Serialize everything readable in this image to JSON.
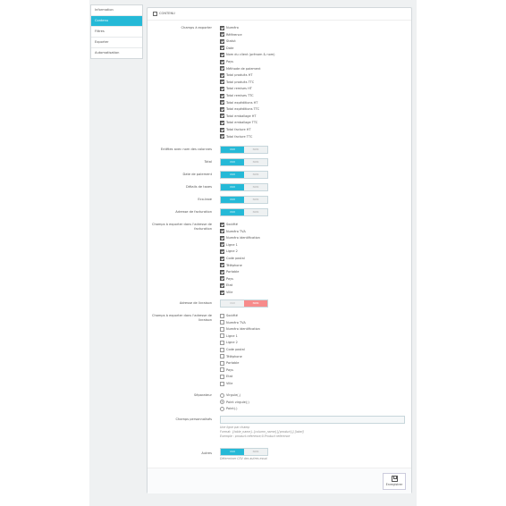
{
  "sidebar": {
    "items": [
      {
        "label": "Information",
        "active": false
      },
      {
        "label": "Contenu",
        "active": true
      },
      {
        "label": "Filtres",
        "active": false
      },
      {
        "label": "Exporter",
        "active": false
      },
      {
        "label": "Automatisation",
        "active": false
      }
    ]
  },
  "panel": {
    "title": "CONTENU"
  },
  "labels": {
    "fields": "Champs à exporter",
    "headers": "Entêtes avec nom des colonnes",
    "total": "Total",
    "payment_date": "Date de paiement",
    "tax_details": "Détails de taxes",
    "ecotax": "Eco-taxe",
    "invoice_address": "Adresse de facturation",
    "invoice_fields": "Champs à exporter dans l'adresse de facturation",
    "delivery_address": "Adresse de livraison",
    "delivery_fields": "Champs à exporter dans l'adresse de livraison",
    "separator": "Séparateur",
    "custom_fields": "Champs personnalisés",
    "others": "Autres"
  },
  "fields": [
    {
      "label": "Numéro",
      "checked": true
    },
    {
      "label": "Référence",
      "checked": true
    },
    {
      "label": "Statut",
      "checked": true
    },
    {
      "label": "Date",
      "checked": true
    },
    {
      "label": "Nom du client (prénom & nom)",
      "checked": true
    },
    {
      "label": "Pays",
      "checked": true
    },
    {
      "label": "Méthode de paiement",
      "checked": true
    },
    {
      "label": "Total produits HT",
      "checked": true
    },
    {
      "label": "Total produits TTC",
      "checked": true
    },
    {
      "label": "Total remises HT",
      "checked": true
    },
    {
      "label": "Total remises TTC",
      "checked": true
    },
    {
      "label": "Total expéditions HT",
      "checked": true
    },
    {
      "label": "Total expéditions TTC",
      "checked": true
    },
    {
      "label": "Total emballage HT",
      "checked": true
    },
    {
      "label": "Total emballage TTC",
      "checked": true
    },
    {
      "label": "Total facture HT",
      "checked": true
    },
    {
      "label": "Total facture TTC",
      "checked": true
    }
  ],
  "toggle": {
    "yes": "OUI",
    "no": "NON"
  },
  "toggle_states": {
    "headers": "yes",
    "total": "yes",
    "payment_date": "yes",
    "tax_details": "yes",
    "ecotax": "yes",
    "invoice_address": "yes",
    "delivery_address": "no",
    "others": "yes"
  },
  "invoice_fields": [
    {
      "label": "Société",
      "checked": true
    },
    {
      "label": "Numéro TVA",
      "checked": true
    },
    {
      "label": "Numéro identification",
      "checked": true
    },
    {
      "label": "Ligne 1",
      "checked": true
    },
    {
      "label": "Ligne 2",
      "checked": true
    },
    {
      "label": "Code postal",
      "checked": true
    },
    {
      "label": "Téléphone",
      "checked": true
    },
    {
      "label": "Portable",
      "checked": true
    },
    {
      "label": "Pays",
      "checked": true
    },
    {
      "label": "Etat",
      "checked": true
    },
    {
      "label": "Ville",
      "checked": true
    }
  ],
  "delivery_fields": [
    {
      "label": "Société",
      "checked": false
    },
    {
      "label": "Numéro TVA",
      "checked": false
    },
    {
      "label": "Numéro identification",
      "checked": false
    },
    {
      "label": "Ligne 1",
      "checked": false
    },
    {
      "label": "Ligne 2",
      "checked": false
    },
    {
      "label": "Code postal",
      "checked": false
    },
    {
      "label": "Téléphone",
      "checked": false
    },
    {
      "label": "Portable",
      "checked": false
    },
    {
      "label": "Pays",
      "checked": false
    },
    {
      "label": "Etat",
      "checked": false
    },
    {
      "label": "Ville",
      "checked": false
    }
  ],
  "separators": [
    {
      "label": "Virgule(,)",
      "selected": false
    },
    {
      "label": "Point virgule(;)",
      "selected": true
    },
    {
      "label": "Point(.)",
      "selected": false
    }
  ],
  "custom": {
    "value": "",
    "help": [
      "Une ligne par champ",
      "Format: {table_name}.{column_name}[{product}].[label]",
      "Exemple : product.reference;0.Product reference"
    ]
  },
  "others_help": "Déterminer CSV des autres essai",
  "save_label": "Enregistrer",
  "colors": {
    "accent": "#25b9d7",
    "no_active": "#f78b8b"
  }
}
